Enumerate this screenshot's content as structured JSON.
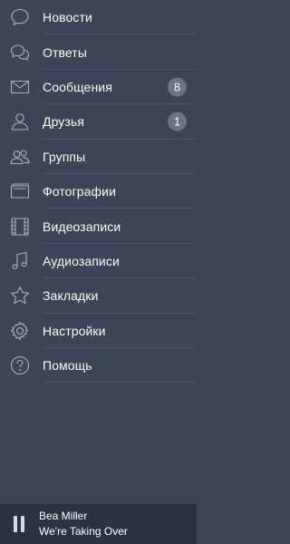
{
  "menu": {
    "items": [
      {
        "label": "Новости",
        "icon": "chat-bubble-icon"
      },
      {
        "label": "Ответы",
        "icon": "chat-bubbles-icon"
      },
      {
        "label": "Сообщения",
        "icon": "envelope-icon",
        "badge": "8"
      },
      {
        "label": "Друзья",
        "icon": "person-icon",
        "badge": "1"
      },
      {
        "label": "Группы",
        "icon": "people-icon"
      },
      {
        "label": "Фотографии",
        "icon": "photos-icon"
      },
      {
        "label": "Видеозаписи",
        "icon": "film-icon"
      },
      {
        "label": "Аудиозаписи",
        "icon": "music-note-icon"
      },
      {
        "label": "Закладки",
        "icon": "star-icon"
      },
      {
        "label": "Настройки",
        "icon": "gear-icon"
      },
      {
        "label": "Помощь",
        "icon": "question-icon"
      }
    ]
  },
  "player": {
    "artist": "Bea Miller",
    "track": "We're Taking Over",
    "state_icon": "pause-icon"
  },
  "colors": {
    "background": "#3a4556",
    "player_background": "#2a3340",
    "icon": "#aab3c0",
    "badge": "#6a7584",
    "divider": "#4a5667"
  }
}
